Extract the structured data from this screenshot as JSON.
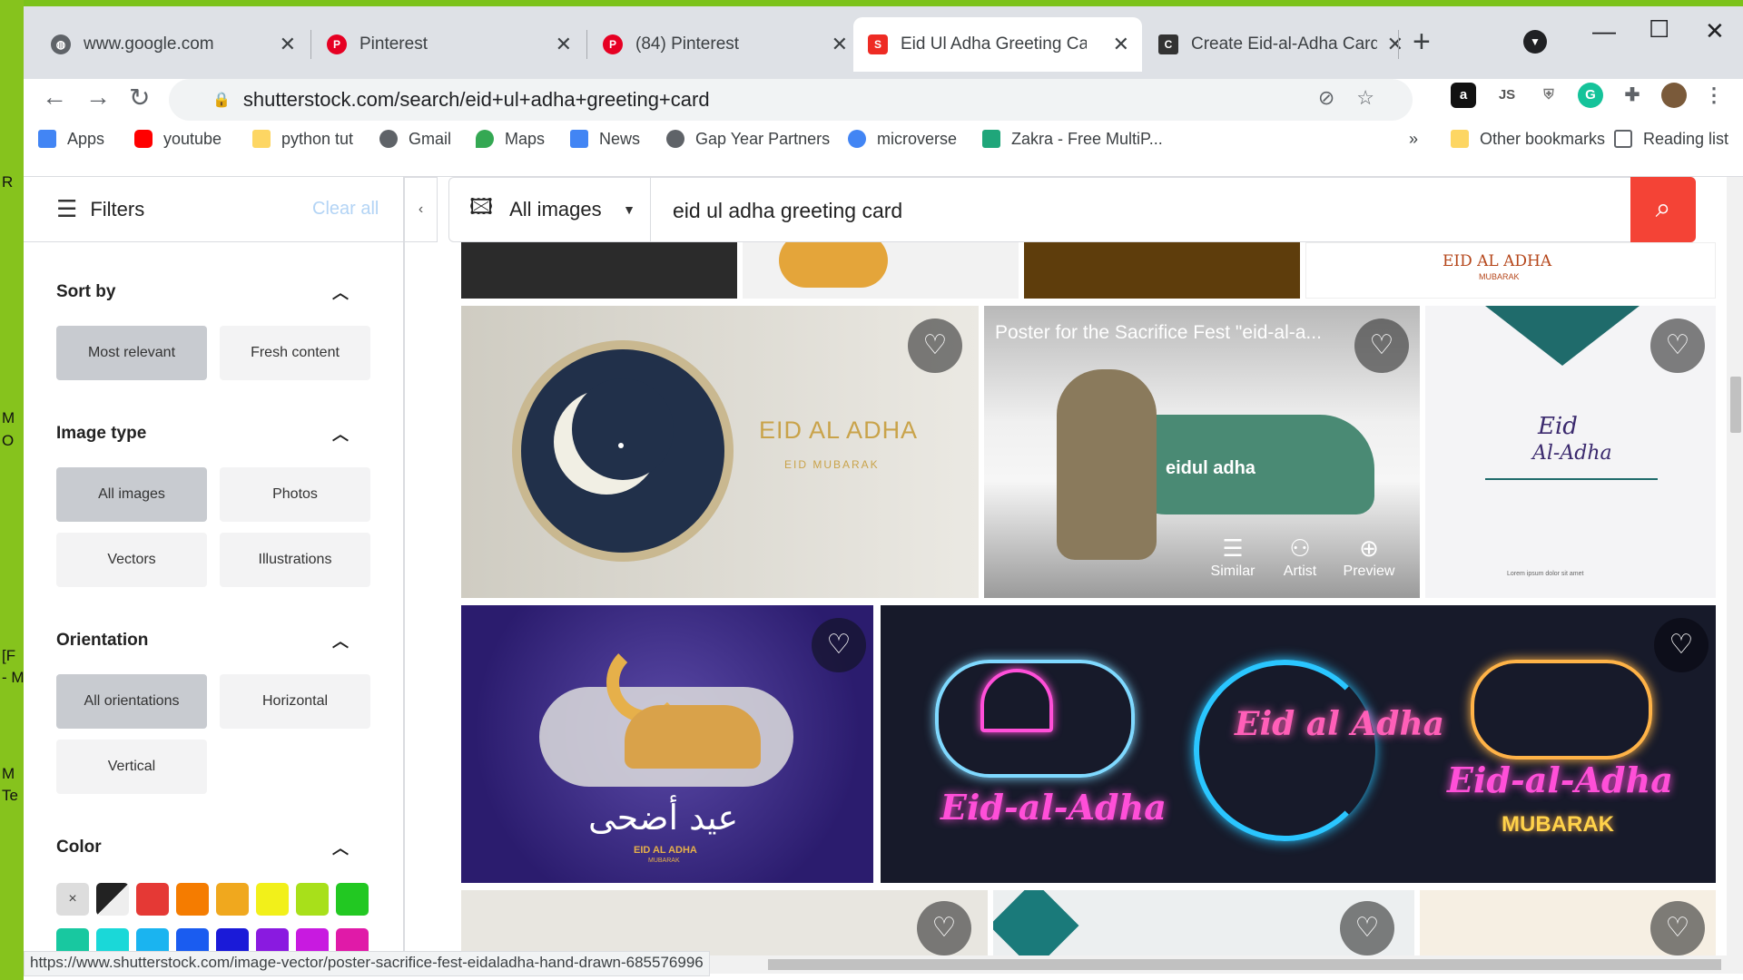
{
  "desktop": {
    "side_text": [
      "R",
      "M",
      "O",
      "[F",
      "- M",
      "M",
      "Te"
    ]
  },
  "tabs": [
    {
      "title": "www.google.com",
      "icon": "globe-icon",
      "color": "#5f6368"
    },
    {
      "title": "Pinterest",
      "icon": "pinterest-icon",
      "color": "#e60023"
    },
    {
      "title": "(84) Pinterest",
      "icon": "pinterest-icon",
      "color": "#e60023"
    },
    {
      "title": "Eid Ul Adha Greeting Card",
      "icon": "shutterstock-icon",
      "color": "#ee2b24"
    },
    {
      "title": "Create Eid-al-Adha Cards",
      "icon": "canva-icon",
      "color": "#333333"
    }
  ],
  "address": {
    "url": "shutterstock.com/search/eid+ul+adha+greeting+card"
  },
  "bookmarks": [
    {
      "label": "Apps",
      "icon": "apps-grid-icon",
      "color": "#4285f4"
    },
    {
      "label": "youtube",
      "icon": "youtube-icon",
      "color": "#ff0000"
    },
    {
      "label": "python tut",
      "icon": "folder-icon",
      "color": "#fdd663"
    },
    {
      "label": "Gmail",
      "icon": "globe-icon",
      "color": "#5f6368"
    },
    {
      "label": "Maps",
      "icon": "maps-pin-icon",
      "color": "#34a853"
    },
    {
      "label": "News",
      "icon": "news-icon",
      "color": "#4285f4"
    },
    {
      "label": "Gap Year Partners",
      "icon": "globe-icon",
      "color": "#5f6368"
    },
    {
      "label": "microverse",
      "icon": "google-icon",
      "color": "#4285f4"
    },
    {
      "label": "Zakra - Free MultiP...",
      "icon": "zakra-icon",
      "color": "#1fa67a"
    }
  ],
  "bookmarks_right": {
    "more": "»",
    "other": "Other bookmarks",
    "reading": "Reading list"
  },
  "filters": {
    "title": "Filters",
    "clear": "Clear all",
    "collapse": "‹",
    "sections": {
      "sort": {
        "title": "Sort by",
        "options": [
          "Most relevant",
          "Fresh content"
        ],
        "selected": "Most relevant"
      },
      "image_type": {
        "title": "Image type",
        "options": [
          "All images",
          "Photos",
          "Vectors",
          "Illustrations"
        ],
        "selected": "All images"
      },
      "orientation": {
        "title": "Orientation",
        "options": [
          "All orientations",
          "Horizontal",
          "Vertical"
        ],
        "selected": "All orientations"
      },
      "color": {
        "title": "Color",
        "clear_symbol": "×",
        "swatches": [
          "#222222",
          "#e53935",
          "#f57c00",
          "#f0a81e",
          "#f2f01a",
          "#a8e01a",
          "#22c822",
          "#18c8a0",
          "#1ad8d8",
          "#1ab4f0",
          "#1a5cf0",
          "#1a1ad8",
          "#8a1ae0",
          "#c81ae0",
          "#e01aa8"
        ]
      }
    }
  },
  "search": {
    "type": "All images",
    "query": "eid ul adha greeting card"
  },
  "results": {
    "tile1": {
      "title": "EID AL ADHA",
      "subtitle": "EID MUBARAK"
    },
    "tile2": {
      "caption": "Poster for the Sacrifice Fest \"eid-al-a...",
      "brush_text": "eidul adha",
      "actions": [
        "Similar",
        "Artist",
        "Preview"
      ]
    },
    "tile3": {
      "title": "Eid",
      "title2": "Al-Adha",
      "small": "Lorem ipsum dolor sit amet"
    },
    "tile4": {
      "title": "EID AL ADHA",
      "arabic": "عيد أضحى",
      "small": "MUBARAK"
    },
    "tile5": {
      "neon1": "Eid-al-Adha",
      "neon2": "Eid al Adha",
      "neon3": "Eid-al-Adha",
      "neon3_sub": "MUBARAK"
    },
    "top_strip": {
      "title": "EID AL ADHA",
      "sub": "MUBARAK"
    }
  },
  "status": {
    "url": "https://www.shutterstock.com/image-vector/poster-sacrifice-fest-eidaladha-hand-drawn-685576996"
  }
}
